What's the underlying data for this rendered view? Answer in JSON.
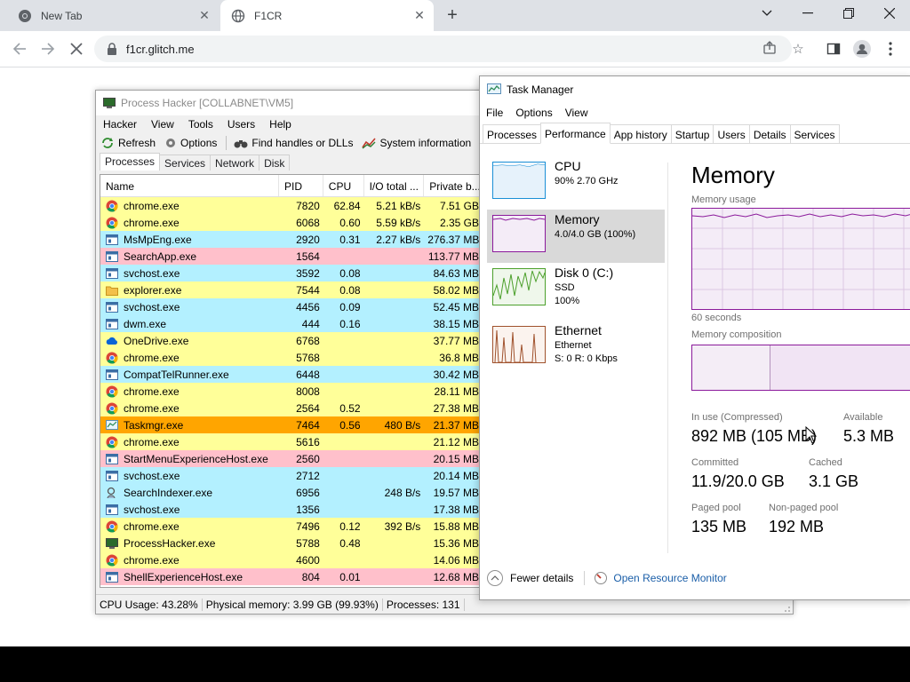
{
  "browser": {
    "tabs": [
      {
        "title": "New Tab",
        "icon": "chrome-icon",
        "active": false
      },
      {
        "title": "F1CR",
        "icon": "globe-icon",
        "active": true
      }
    ],
    "new_tab_label": "+",
    "url": "f1cr.glitch.me",
    "window_controls": [
      "chevron-down-icon",
      "minimize-icon",
      "restore-icon",
      "close-icon"
    ]
  },
  "process_hacker": {
    "title": "Process Hacker [COLLABNET\\VM5]",
    "menu": [
      "Hacker",
      "View",
      "Tools",
      "Users",
      "Help"
    ],
    "toolbar": {
      "refresh": "Refresh",
      "options": "Options",
      "find": "Find handles or DLLs",
      "sysinfo": "System information"
    },
    "tabs": [
      "Processes",
      "Services",
      "Network",
      "Disk"
    ],
    "columns": [
      "Name",
      "PID",
      "CPU",
      "I/O total ...",
      "Private b..."
    ],
    "rows": [
      {
        "name": "chrome.exe",
        "pid": "7820",
        "cpu": "62.84",
        "io": "5.21 kB/s",
        "priv": "7.51 GB",
        "bg": "#ffff99",
        "icon": "chrome"
      },
      {
        "name": "chrome.exe",
        "pid": "6068",
        "cpu": "0.60",
        "io": "5.59 kB/s",
        "priv": "2.35 GB",
        "bg": "#ffff99",
        "icon": "chrome"
      },
      {
        "name": "MsMpEng.exe",
        "pid": "2920",
        "cpu": "0.31",
        "io": "2.27 kB/s",
        "priv": "276.37 MB",
        "bg": "#b3f0ff",
        "icon": "window"
      },
      {
        "name": "SearchApp.exe",
        "pid": "1564",
        "cpu": "",
        "io": "",
        "priv": "113.77 MB",
        "bg": "#ffc0cb",
        "icon": "window"
      },
      {
        "name": "svchost.exe",
        "pid": "3592",
        "cpu": "0.08",
        "io": "",
        "priv": "84.63 MB",
        "bg": "#b3f0ff",
        "icon": "window"
      },
      {
        "name": "explorer.exe",
        "pid": "7544",
        "cpu": "0.08",
        "io": "",
        "priv": "58.02 MB",
        "bg": "#ffff99",
        "icon": "folder"
      },
      {
        "name": "svchost.exe",
        "pid": "4456",
        "cpu": "0.09",
        "io": "",
        "priv": "52.45 MB",
        "bg": "#b3f0ff",
        "icon": "window"
      },
      {
        "name": "dwm.exe",
        "pid": "444",
        "cpu": "0.16",
        "io": "",
        "priv": "38.15 MB",
        "bg": "#b3f0ff",
        "icon": "window"
      },
      {
        "name": "OneDrive.exe",
        "pid": "6768",
        "cpu": "",
        "io": "",
        "priv": "37.77 MB",
        "bg": "#ffff99",
        "icon": "cloud"
      },
      {
        "name": "chrome.exe",
        "pid": "5768",
        "cpu": "",
        "io": "",
        "priv": "36.8 MB",
        "bg": "#ffff99",
        "icon": "chrome"
      },
      {
        "name": "CompatTelRunner.exe",
        "pid": "6448",
        "cpu": "",
        "io": "",
        "priv": "30.42 MB",
        "bg": "#b3f0ff",
        "icon": "window"
      },
      {
        "name": "chrome.exe",
        "pid": "8008",
        "cpu": "",
        "io": "",
        "priv": "28.11 MB",
        "bg": "#ffff99",
        "icon": "chrome"
      },
      {
        "name": "chrome.exe",
        "pid": "2564",
        "cpu": "0.52",
        "io": "",
        "priv": "27.38 MB",
        "bg": "#ffff99",
        "icon": "chrome"
      },
      {
        "name": "Taskmgr.exe",
        "pid": "7464",
        "cpu": "0.56",
        "io": "480 B/s",
        "priv": "21.37 MB",
        "bg": "#ffa500",
        "icon": "taskmgr"
      },
      {
        "name": "chrome.exe",
        "pid": "5616",
        "cpu": "",
        "io": "",
        "priv": "21.12 MB",
        "bg": "#ffff99",
        "icon": "chrome"
      },
      {
        "name": "StartMenuExperienceHost.exe",
        "pid": "2560",
        "cpu": "",
        "io": "",
        "priv": "20.15 MB",
        "bg": "#ffc0cb",
        "icon": "window"
      },
      {
        "name": "svchost.exe",
        "pid": "2712",
        "cpu": "",
        "io": "",
        "priv": "20.14 MB",
        "bg": "#b3f0ff",
        "icon": "window"
      },
      {
        "name": "SearchIndexer.exe",
        "pid": "6956",
        "cpu": "",
        "io": "248 B/s",
        "priv": "19.57 MB",
        "bg": "#b3f0ff",
        "icon": "search"
      },
      {
        "name": "svchost.exe",
        "pid": "1356",
        "cpu": "",
        "io": "",
        "priv": "17.38 MB",
        "bg": "#b3f0ff",
        "icon": "window"
      },
      {
        "name": "chrome.exe",
        "pid": "7496",
        "cpu": "0.12",
        "io": "392 B/s",
        "priv": "15.88 MB",
        "bg": "#ffff99",
        "icon": "chrome"
      },
      {
        "name": "ProcessHacker.exe",
        "pid": "5788",
        "cpu": "0.48",
        "io": "",
        "priv": "15.36 MB",
        "bg": "#ffff99",
        "icon": "hacker"
      },
      {
        "name": "chrome.exe",
        "pid": "4600",
        "cpu": "",
        "io": "",
        "priv": "14.06 MB",
        "bg": "#ffff99",
        "icon": "chrome"
      },
      {
        "name": "ShellExperienceHost.exe",
        "pid": "804",
        "cpu": "0.01",
        "io": "",
        "priv": "12.68 MB",
        "bg": "#ffc0cb",
        "icon": "window"
      }
    ],
    "status": {
      "cpu": "CPU Usage: 43.28%",
      "memory": "Physical memory: 3.99 GB (99.93%)",
      "processes": "Processes: 131"
    }
  },
  "task_manager": {
    "title": "Task Manager",
    "menu": [
      "File",
      "Options",
      "View"
    ],
    "tabs": [
      "Processes",
      "Performance",
      "App history",
      "Startup",
      "Users",
      "Details",
      "Services"
    ],
    "active_tab": "Performance",
    "resources": [
      {
        "title": "CPU",
        "line1": "90%  2.70 GHz",
        "line2": "",
        "color": "#1a8fd6"
      },
      {
        "title": "Memory",
        "line1": "4.0/4.0 GB (100%)",
        "line2": "",
        "color": "#8b1a9b"
      },
      {
        "title": "Disk 0 (C:)",
        "line1": "SSD",
        "line2": "100%",
        "color": "#4ca02c"
      },
      {
        "title": "Ethernet",
        "line1": "Ethernet",
        "line2": "S: 0  R: 0 Kbps",
        "color": "#a0522d"
      }
    ],
    "main": {
      "heading": "Memory",
      "usage_label": "Memory usage",
      "time_label": "60 seconds",
      "composition_label": "Memory composition",
      "in_use_label": "In use (Compressed)",
      "in_use": "892 MB (105 MB)",
      "available_label": "Available",
      "available": "5.3 MB",
      "committed_label": "Committed",
      "committed": "11.9/20.0 GB",
      "cached_label": "Cached",
      "cached": "3.1 GB",
      "paged_label": "Paged pool",
      "paged": "135 MB",
      "nonpaged_label": "Non-paged pool",
      "nonpaged": "192 MB"
    },
    "footer": {
      "fewer_details": "Fewer details",
      "open_resource_monitor": "Open Resource Monitor"
    }
  }
}
